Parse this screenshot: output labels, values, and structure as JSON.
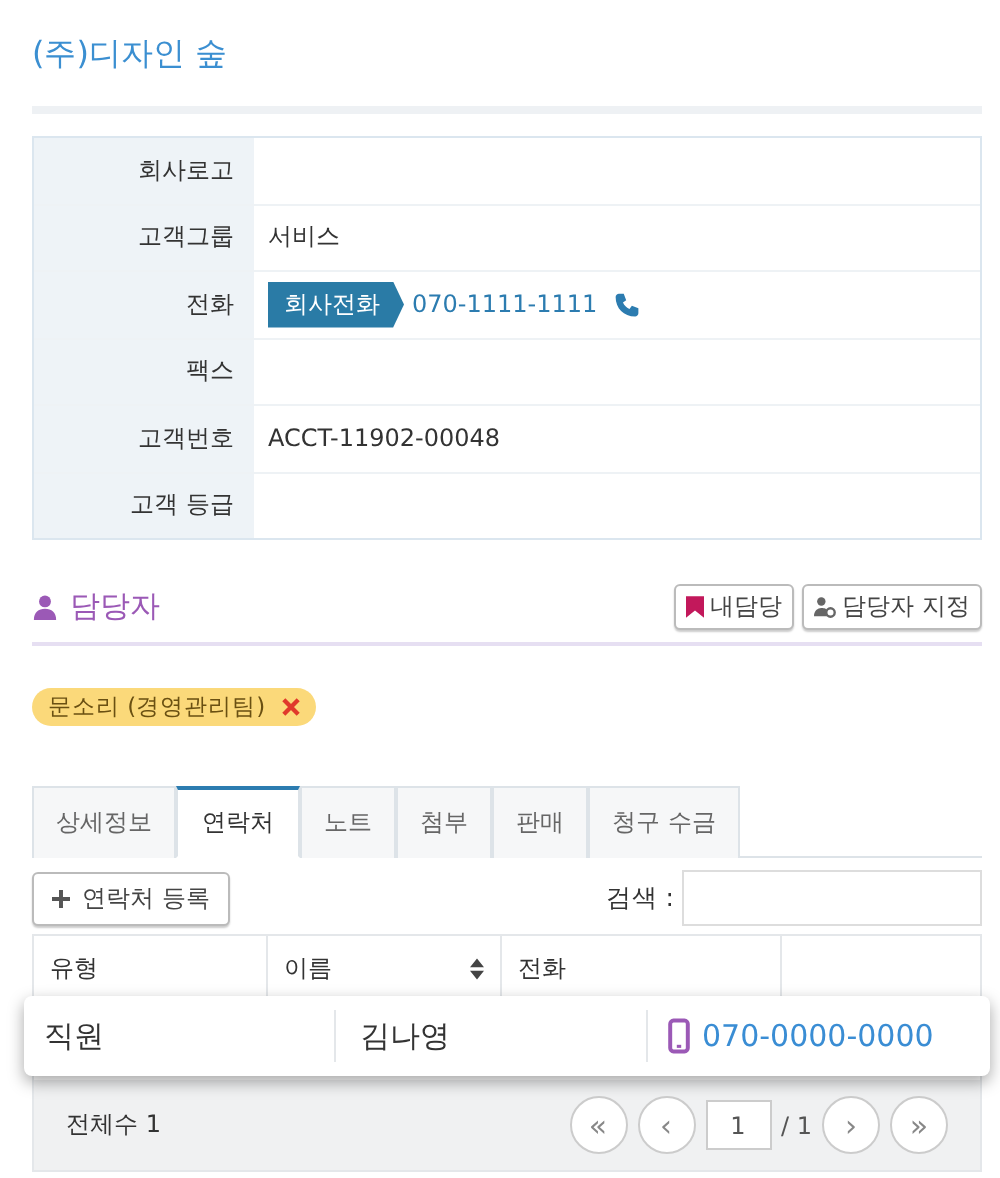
{
  "title": "(주)디자인 숲",
  "info_rows": [
    {
      "label": "회사로고",
      "kind": "empty"
    },
    {
      "label": "고객그룹",
      "kind": "text",
      "value": "서비스"
    },
    {
      "label": "전화",
      "kind": "phone",
      "tag": "회사전화",
      "value": "070-1111-1111"
    },
    {
      "label": "팩스",
      "kind": "empty"
    },
    {
      "label": "고객번호",
      "kind": "text",
      "value": "ACCT-11902-00048"
    },
    {
      "label": "고객 등급",
      "kind": "empty"
    }
  ],
  "owner_section": {
    "title": "담당자",
    "buttons": [
      {
        "kind": "bookmark",
        "label": "내담당"
      },
      {
        "kind": "assign",
        "label": "담당자 지정"
      }
    ],
    "owners": [
      {
        "label": "문소리 (경영관리팀)",
        "removable": true
      }
    ]
  },
  "tabs": [
    {
      "label": "상세정보",
      "selected": false
    },
    {
      "label": "연락처",
      "selected": true
    },
    {
      "label": "노트",
      "selected": false
    },
    {
      "label": "첨부",
      "selected": false
    },
    {
      "label": "판매",
      "selected": false
    },
    {
      "label": "청구 수금",
      "selected": false
    }
  ],
  "add_button": "연락처 등록",
  "search_label": "검색 :",
  "table": {
    "columns": [
      {
        "label": "유형",
        "sortable": false
      },
      {
        "label": "이름",
        "sortable": true
      },
      {
        "label": "전화",
        "sortable": false
      }
    ],
    "rows": [
      {
        "type": "직원",
        "name": "김나영",
        "phone": "070-0000-0000"
      }
    ]
  },
  "footer": {
    "total": "전체수 1",
    "page": "1",
    "page_total": "/ 1",
    "first": "«",
    "prev": "‹",
    "next": "›",
    "last": "»"
  }
}
